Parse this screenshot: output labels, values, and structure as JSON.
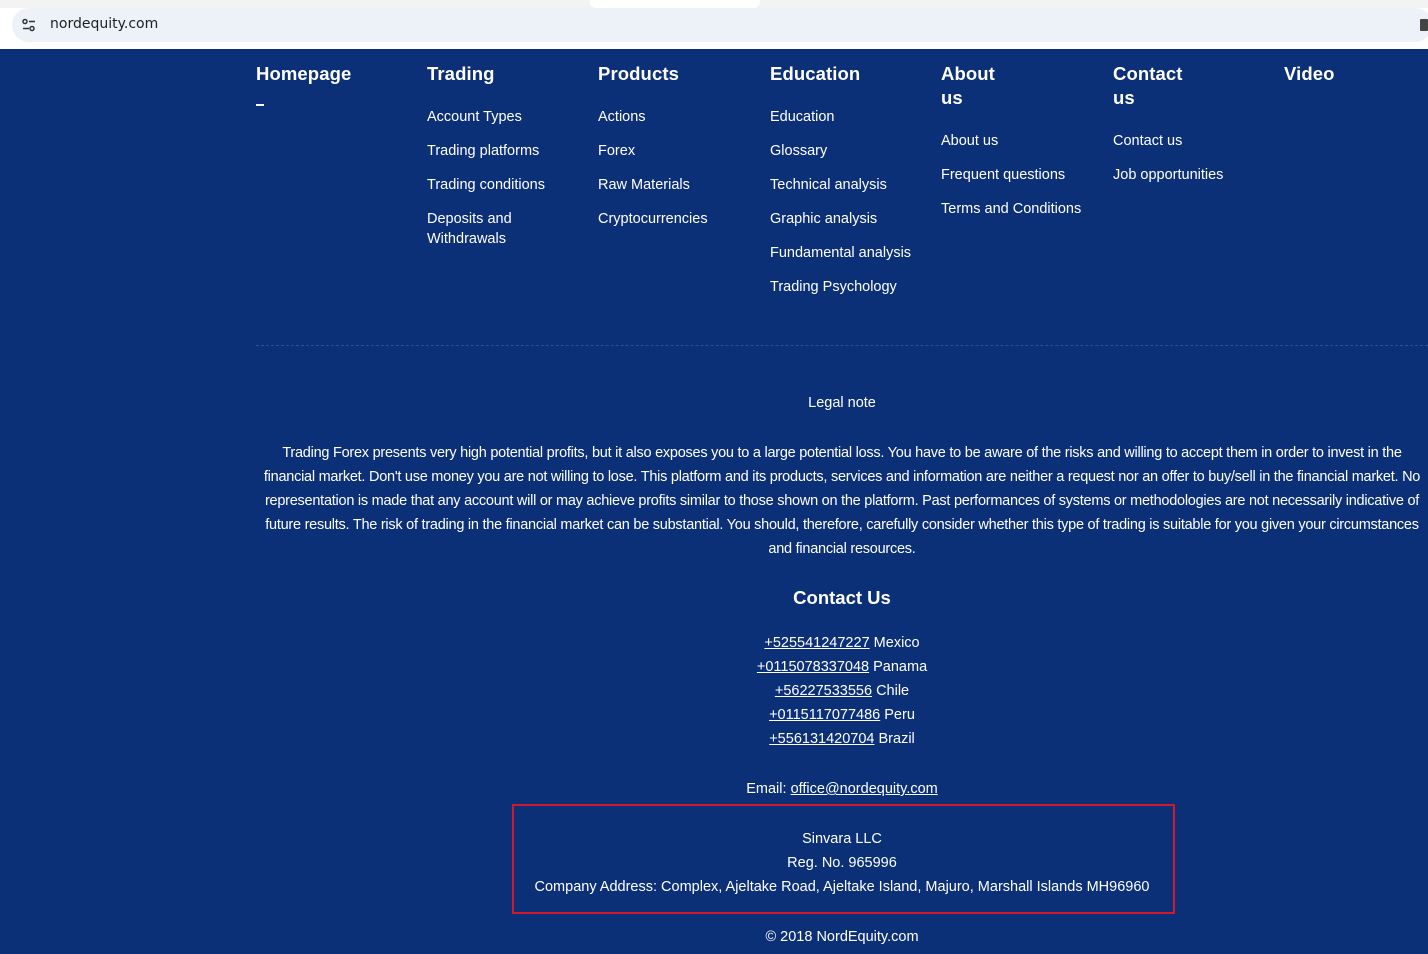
{
  "browser": {
    "url": "nordequity.com",
    "site_info_icon": "tune-icon"
  },
  "nav": {
    "homepage": {
      "title": "Homepage"
    },
    "trading": {
      "title": "Trading",
      "items": [
        "Account Types",
        "Trading platforms",
        "Trading conditions",
        "Deposits and Withdrawals"
      ]
    },
    "products": {
      "title": "Products",
      "items": [
        "Actions",
        "Forex",
        "Raw Materials",
        "Cryptocurrencies"
      ]
    },
    "education": {
      "title": "Education",
      "items": [
        "Education",
        "Glossary",
        "Technical analysis",
        "Graphic analysis",
        "Fundamental analysis",
        "Trading Psychology"
      ]
    },
    "about": {
      "title": "About us",
      "items": [
        "About us",
        "Frequent questions",
        "Terms and Conditions"
      ]
    },
    "contact": {
      "title": "Contact us",
      "items": [
        "Contact us",
        "Job opportunities"
      ]
    },
    "video": {
      "title": "Video"
    }
  },
  "legal": {
    "title": "Legal note",
    "text": "Trading Forex presents very high potential profits, but it also exposes you to a large potential loss. You have to be aware of the risks and willing to accept them in order to invest in the financial market. Don't use money you are not willing to lose. This platform and its products, services and information are neither a request nor an offer to buy/sell in the financial market. No representation is made that any account will or may achieve profits similar to those shown on the platform. Past performances of systems or methodologies are not necessarily indicative of future results. The risk of trading in the financial market can be substantial. You should, therefore, carefully consider whether this type of trading is suitable for you given your circumstances and financial resources."
  },
  "contact_section": {
    "title": "Contact Us",
    "phones": [
      {
        "number": "+525541247227",
        "country": "Mexico"
      },
      {
        "number": "+0115078337048",
        "country": "Panama"
      },
      {
        "number": "+56227533556",
        "country": "Chile"
      },
      {
        "number": "+0115117077486",
        "country": "Peru"
      },
      {
        "number": "+556131420704",
        "country": "Brazil"
      }
    ],
    "email_label": "Email:",
    "email": "office@nordequity.com"
  },
  "company": {
    "name": "Sinvara LLC",
    "reg": "Reg. No. 965996",
    "address": "Company Address: Complex, Ajeltake Road, Ajeltake Island, Majuro, Marshall Islands MH96960",
    "highlight_color": "#d01a2c"
  },
  "copyright": "© 2018 NordEquity.com",
  "colors": {
    "background": "#0c3078",
    "text": "#ffffff"
  }
}
